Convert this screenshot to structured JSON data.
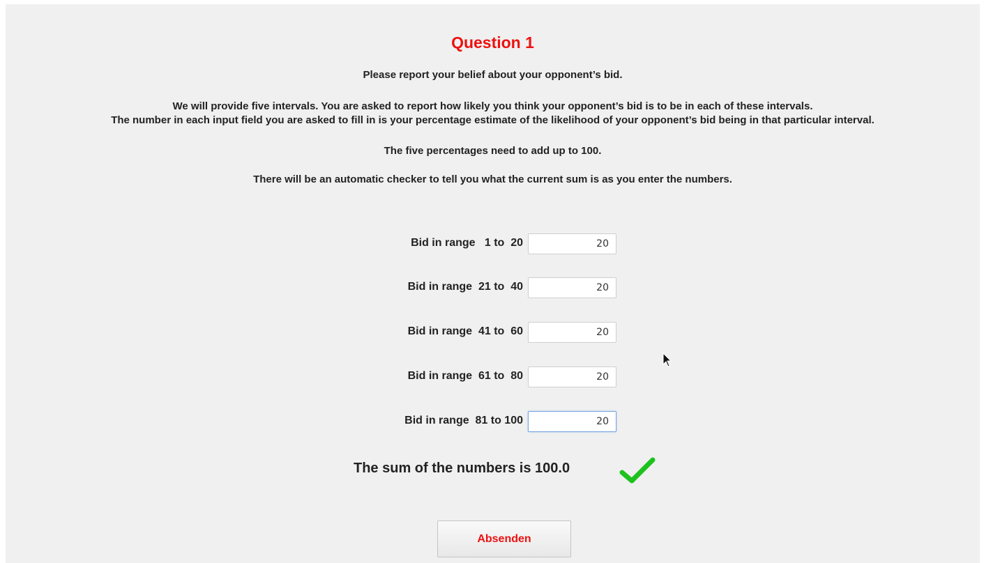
{
  "question": {
    "title": "Question 1",
    "instructions": [
      "Please report your belief about your opponent’s bid.",
      "We will provide five intervals.  You are asked to report how likely you think your opponent’s bid is to be in each of these intervals.",
      "The number in each input field you are asked to fill in is your percentage estimate of the likelihood of your opponent’s bid being in that particular interval.",
      "The five percentages need to add up to 100.",
      "There will be an automatic checker to tell you what the current sum is as you enter the numbers."
    ]
  },
  "bids": [
    {
      "label": "Bid in range   1 to  20",
      "value": "20"
    },
    {
      "label": "Bid in range  21 to  40",
      "value": "20"
    },
    {
      "label": "Bid in range  41 to  60",
      "value": "20"
    },
    {
      "label": "Bid in range  61 to  80",
      "value": "20"
    },
    {
      "label": "Bid in range  81 to 100",
      "value": "20"
    }
  ],
  "sum": {
    "text": "The sum of the numbers is 100.0",
    "status_icon": "checkmark-icon",
    "status_color": "#1ec21e"
  },
  "submit": {
    "label": "Absenden"
  },
  "colors": {
    "accent": "#ee1111",
    "background": "#f0f0f0"
  }
}
